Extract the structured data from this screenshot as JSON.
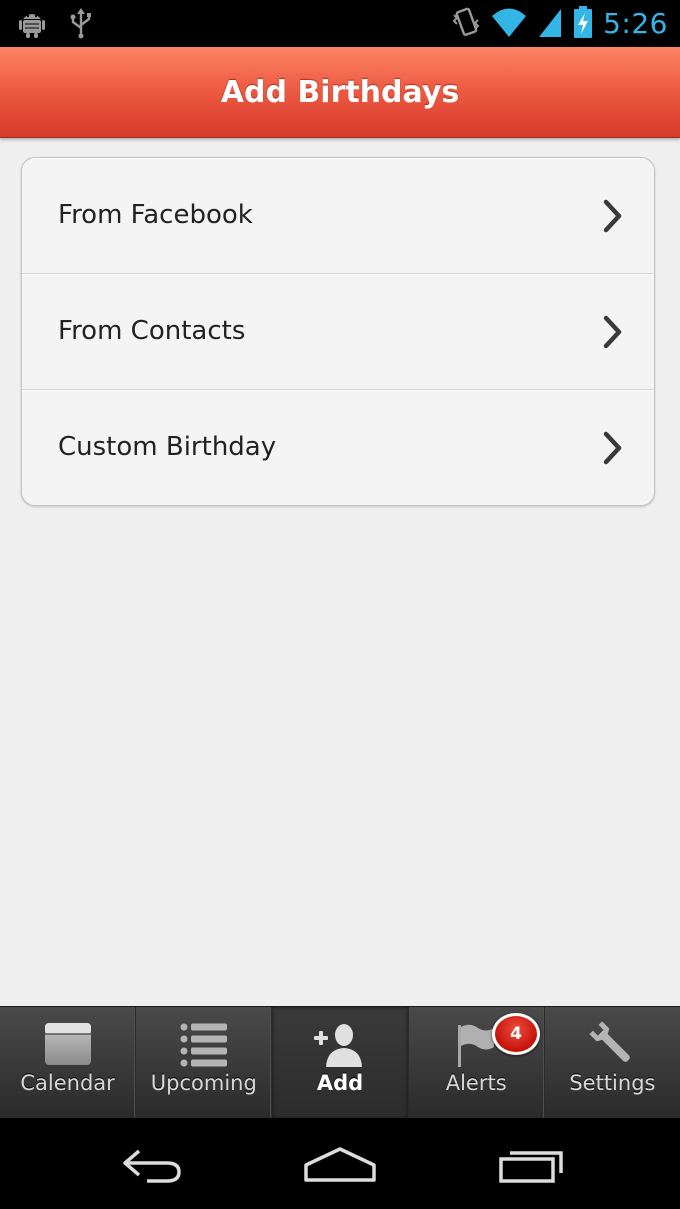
{
  "status_bar": {
    "time": "5:26",
    "icons": [
      "android-debug-icon",
      "usb-icon",
      "vibrate-icon",
      "wifi-icon",
      "signal-icon",
      "battery-charging-icon"
    ]
  },
  "header": {
    "title": "Add Birthdays"
  },
  "menu": {
    "items": [
      {
        "label": "From Facebook",
        "icon": "chevron-right-icon"
      },
      {
        "label": "From Contacts",
        "icon": "chevron-right-icon"
      },
      {
        "label": "Custom Birthday",
        "icon": "chevron-right-icon"
      }
    ]
  },
  "tabs": {
    "active": "Add",
    "items": [
      {
        "label": "Calendar",
        "icon": "calendar-icon"
      },
      {
        "label": "Upcoming",
        "icon": "list-icon"
      },
      {
        "label": "Add",
        "icon": "add-person-icon"
      },
      {
        "label": "Alerts",
        "icon": "flag-icon"
      },
      {
        "label": "Settings",
        "icon": "wrench-icon"
      }
    ],
    "alerts_badge": "4"
  },
  "nav_bar": {
    "buttons": [
      "back-icon",
      "home-icon",
      "recents-icon"
    ]
  },
  "colors": {
    "header_gradient_top": "#fb8466",
    "header_gradient_bottom": "#d73a2b",
    "clock": "#33b5e5",
    "badge": "#c4140c"
  }
}
